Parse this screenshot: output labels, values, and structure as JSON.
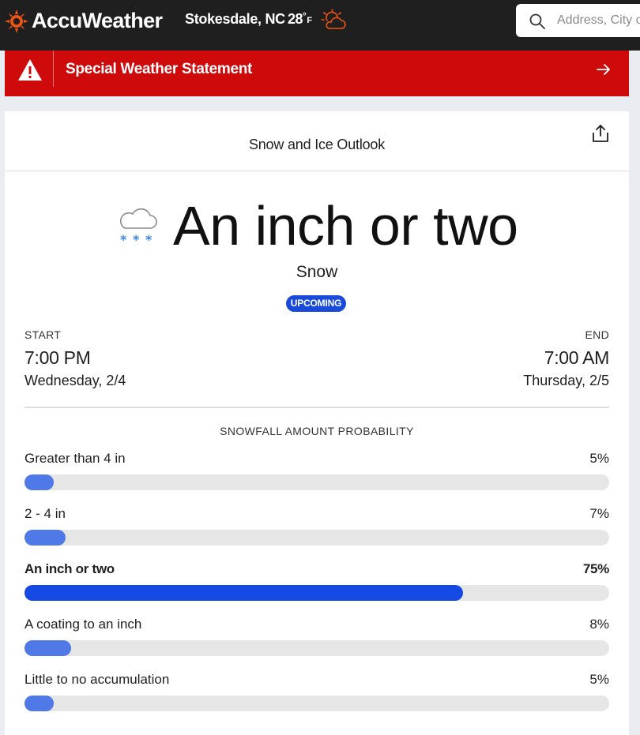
{
  "header": {
    "brand": "AccuWeather",
    "brand_color": "#f05514",
    "location": "Stokesdale, NC",
    "temperature": "28",
    "temp_unit": "F",
    "weather_icon": "mostly-clear-night-icon",
    "search": {
      "placeholder": "Address, City or Zip"
    }
  },
  "alert": {
    "text": "Special Weather Statement",
    "color": "#cf0a0a",
    "icon": "warning-triangle-icon"
  },
  "card": {
    "title": "Snow and Ice Outlook",
    "headline": "An inch or two",
    "precip_type": "Snow",
    "status": "UPCOMING",
    "start": {
      "label": "START",
      "time": "7:00 PM",
      "date": "Wednesday, 2/4"
    },
    "end": {
      "label": "END",
      "time": "7:00 AM",
      "date": "Thursday, 2/5"
    },
    "probability_title": "SNOWFALL AMOUNT PROBABILITY",
    "probabilities": [
      {
        "label": "Greater than 4 in",
        "pct_text": "5%",
        "value": 5,
        "active": false
      },
      {
        "label": "2 - 4 in",
        "pct_text": "7%",
        "value": 7,
        "active": false
      },
      {
        "label": "An inch or two",
        "pct_text": "75%",
        "value": 75,
        "active": true
      },
      {
        "label": "A coating to an inch",
        "pct_text": "8%",
        "value": 8,
        "active": false
      },
      {
        "label": "Little to no accumulation",
        "pct_text": "5%",
        "value": 5,
        "active": false
      }
    ]
  }
}
